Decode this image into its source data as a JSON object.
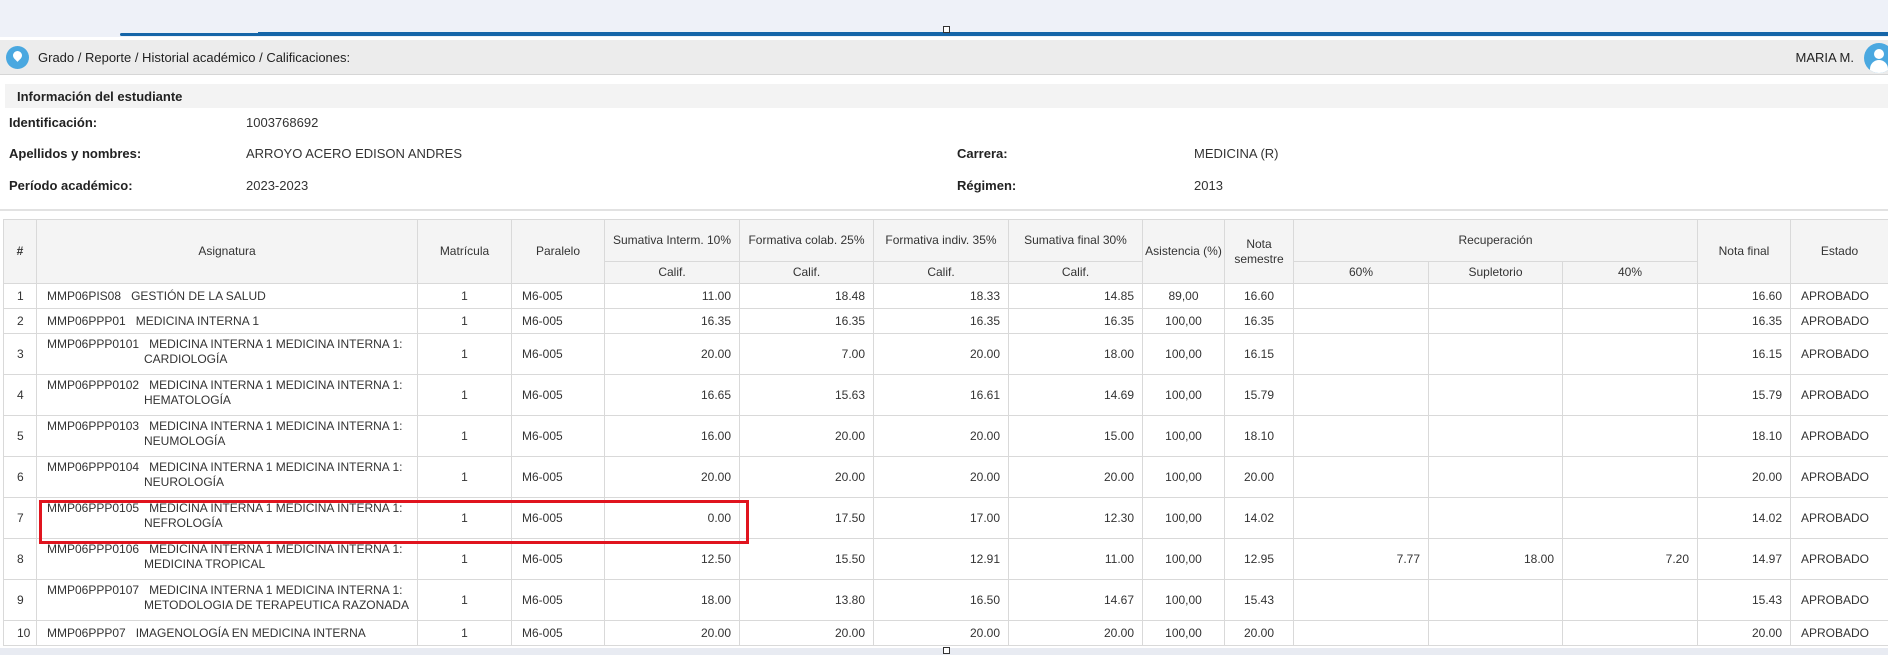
{
  "breadcrumb": "Grado / Reporte / Historial académico / Calificaciones:",
  "user_name": "MARIA M.",
  "student": {
    "section_title": "Información del estudiante",
    "id_label": "Identificación:",
    "id_value": "1003768692",
    "name_label": "Apellidos y nombres:",
    "name_value": "ARROYO ACERO EDISON ANDRES",
    "period_label": "Período académico:",
    "period_value": "2023-2023",
    "career_label": "Carrera:",
    "career_value": "MEDICINA (R)",
    "regime_label": "Régimen:",
    "regime_value": "2013"
  },
  "table": {
    "headers": {
      "num": "#",
      "asignatura": "Asignatura",
      "matricula": "Matrícula",
      "paralelo": "Paralelo",
      "sum_interm": "Sumativa Interm. 10%",
      "form_colab": "Formativa colab. 25%",
      "form_indiv": "Formativa indiv. 35%",
      "sum_final": "Sumativa final 30%",
      "asistencia": "Asistencia (%)",
      "nota_semestre": "Nota semestre",
      "recuperacion": "Recuperación",
      "nota_final": "Nota final",
      "estado": "Estado",
      "calif": "Calif.",
      "rec60": "60%",
      "supletorio": "Supletorio",
      "rec40": "40%"
    },
    "rows": [
      {
        "n": "1",
        "code": "MMP06PIS08",
        "name": "GESTIÓN DE LA SALUD",
        "name2": "",
        "mat": "1",
        "par": "M6-005",
        "si": "11.00",
        "fc": "18.48",
        "fi": "18.33",
        "sf": "14.85",
        "asis": "89,00",
        "ns": "16.60",
        "r60": "",
        "sup": "",
        "r40": "",
        "nf": "16.60",
        "est": "APROBADO"
      },
      {
        "n": "2",
        "code": "MMP06PPP01",
        "name": "MEDICINA INTERNA 1",
        "name2": "",
        "mat": "1",
        "par": "M6-005",
        "si": "16.35",
        "fc": "16.35",
        "fi": "16.35",
        "sf": "16.35",
        "asis": "100,00",
        "ns": "16.35",
        "r60": "",
        "sup": "",
        "r40": "",
        "nf": "16.35",
        "est": "APROBADO"
      },
      {
        "n": "3",
        "code": "MMP06PPP0101",
        "name": "MEDICINA INTERNA 1 MEDICINA INTERNA 1:",
        "name2": "CARDIOLOGÍA",
        "mat": "1",
        "par": "M6-005",
        "si": "20.00",
        "fc": "7.00",
        "fi": "20.00",
        "sf": "18.00",
        "asis": "100,00",
        "ns": "16.15",
        "r60": "",
        "sup": "",
        "r40": "",
        "nf": "16.15",
        "est": "APROBADO"
      },
      {
        "n": "4",
        "code": "MMP06PPP0102",
        "name": "MEDICINA INTERNA 1 MEDICINA INTERNA 1:",
        "name2": "HEMATOLOGÍA",
        "mat": "1",
        "par": "M6-005",
        "si": "16.65",
        "fc": "15.63",
        "fi": "16.61",
        "sf": "14.69",
        "asis": "100,00",
        "ns": "15.79",
        "r60": "",
        "sup": "",
        "r40": "",
        "nf": "15.79",
        "est": "APROBADO"
      },
      {
        "n": "5",
        "code": "MMP06PPP0103",
        "name": "MEDICINA INTERNA 1 MEDICINA INTERNA 1:",
        "name2": "NEUMOLOGÍA",
        "mat": "1",
        "par": "M6-005",
        "si": "16.00",
        "fc": "20.00",
        "fi": "20.00",
        "sf": "15.00",
        "asis": "100,00",
        "ns": "18.10",
        "r60": "",
        "sup": "",
        "r40": "",
        "nf": "18.10",
        "est": "APROBADO"
      },
      {
        "n": "6",
        "code": "MMP06PPP0104",
        "name": "MEDICINA INTERNA 1 MEDICINA INTERNA 1:",
        "name2": "NEUROLOGÍA",
        "mat": "1",
        "par": "M6-005",
        "si": "20.00",
        "fc": "20.00",
        "fi": "20.00",
        "sf": "20.00",
        "asis": "100,00",
        "ns": "20.00",
        "r60": "",
        "sup": "",
        "r40": "",
        "nf": "20.00",
        "est": "APROBADO"
      },
      {
        "n": "7",
        "code": "MMP06PPP0105",
        "name": "MEDICINA INTERNA 1 MEDICINA INTERNA 1:",
        "name2": "NEFROLOGÍA",
        "mat": "1",
        "par": "M6-005",
        "si": "0.00",
        "fc": "17.50",
        "fi": "17.00",
        "sf": "12.30",
        "asis": "100,00",
        "ns": "14.02",
        "r60": "",
        "sup": "",
        "r40": "",
        "nf": "14.02",
        "est": "APROBADO"
      },
      {
        "n": "8",
        "code": "MMP06PPP0106",
        "name": "MEDICINA INTERNA 1 MEDICINA INTERNA 1:",
        "name2": "MEDICINA TROPICAL",
        "mat": "1",
        "par": "M6-005",
        "si": "12.50",
        "fc": "15.50",
        "fi": "12.91",
        "sf": "11.00",
        "asis": "100,00",
        "ns": "12.95",
        "r60": "7.77",
        "sup": "18.00",
        "r40": "7.20",
        "nf": "14.97",
        "est": "APROBADO"
      },
      {
        "n": "9",
        "code": "MMP06PPP0107",
        "name": "MEDICINA INTERNA 1 MEDICINA INTERNA 1:",
        "name2": "METODOLOGIA DE TERAPEUTICA RAZONADA",
        "mat": "1",
        "par": "M6-005",
        "si": "18.00",
        "fc": "13.80",
        "fi": "16.50",
        "sf": "14.67",
        "asis": "100,00",
        "ns": "15.43",
        "r60": "",
        "sup": "",
        "r40": "",
        "nf": "15.43",
        "est": "APROBADO"
      },
      {
        "n": "10",
        "code": "MMP06PPP07",
        "name": "IMAGENOLOGÍA EN MEDICINA INTERNA",
        "name2": "",
        "mat": "1",
        "par": "M6-005",
        "si": "20.00",
        "fc": "20.00",
        "fi": "20.00",
        "sf": "20.00",
        "asis": "100,00",
        "ns": "20.00",
        "r60": "",
        "sup": "",
        "r40": "",
        "nf": "20.00",
        "est": "APROBADO"
      }
    ]
  },
  "colors": {
    "accent": "#1565a8",
    "icon": "#4aa8e0",
    "highlight": "#e0141e"
  }
}
